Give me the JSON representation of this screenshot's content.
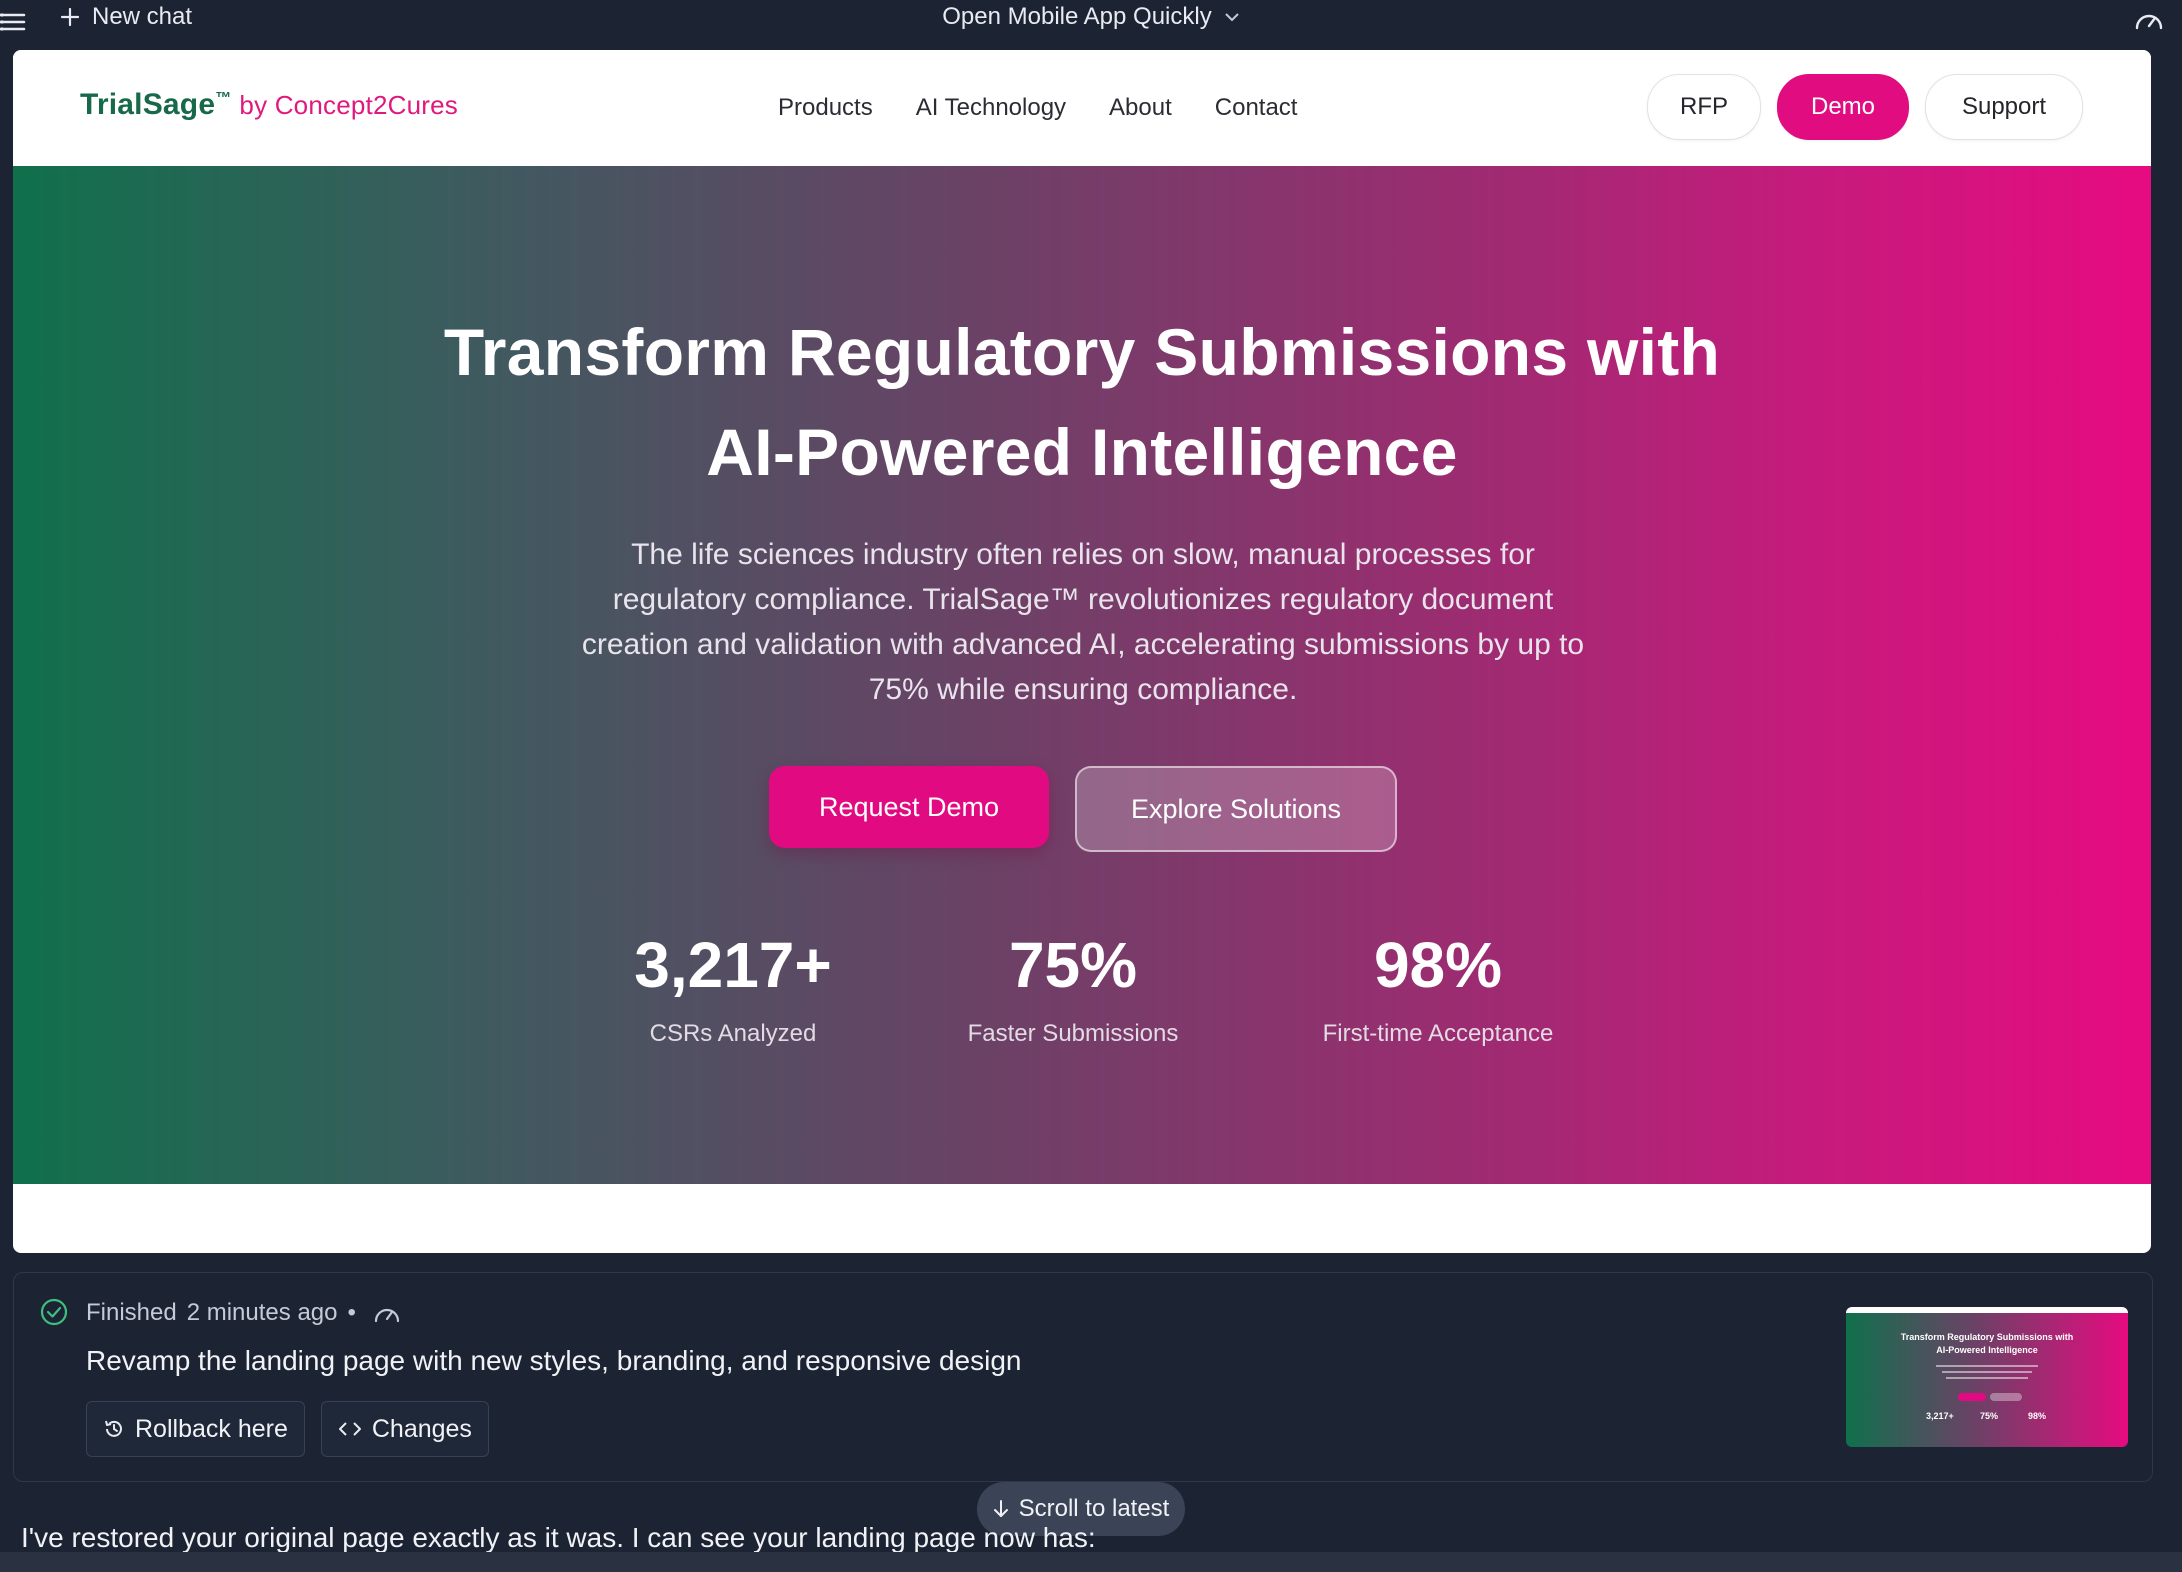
{
  "topbar": {
    "new_chat_label": "New chat",
    "center_title": "Open Mobile App Quickly"
  },
  "preview": {
    "brand_name": "TrialSage",
    "brand_tm": "™",
    "brand_by": "by Concept2Cures",
    "nav_links": [
      "Products",
      "AI Technology",
      "About",
      "Contact"
    ],
    "nav_buttons": {
      "rfp": "RFP",
      "demo": "Demo",
      "support": "Support"
    },
    "hero": {
      "title_line1": "Transform Regulatory Submissions with",
      "title_line2": "AI-Powered Intelligence",
      "description": "The life sciences industry often relies on slow, manual processes for regulatory compliance. TrialSage™ revolutionizes regulatory document creation and validation with advanced AI, accelerating submissions by up to 75% while ensuring compliance.",
      "primary_button": "Request Demo",
      "secondary_button": "Explore Solutions",
      "stats": [
        {
          "value": "3,217+",
          "label": "CSRs Analyzed"
        },
        {
          "value": "75%",
          "label": "Faster Submissions"
        },
        {
          "value": "98%",
          "label": "First-time Acceptance"
        }
      ]
    }
  },
  "task_card": {
    "status": "Finished",
    "time": "2 minutes ago",
    "separator": "•",
    "title": "Revamp the landing page with new styles, branding, and responsive design",
    "rollback_label": "Rollback here",
    "changes_label": "Changes",
    "thumbnail": {
      "title": "Transform Regulatory Submissions with AI-Powered Intelligence",
      "stats": [
        "3,217+",
        "75%",
        "98%"
      ]
    }
  },
  "scroll_label": "Scroll to latest",
  "chat_message": "I've restored your original page exactly as it was. I can see your landing page now has:",
  "colors": {
    "brand_green": "#17694a",
    "brand_pink": "#e10d80",
    "app_bg": "#1c2433"
  }
}
